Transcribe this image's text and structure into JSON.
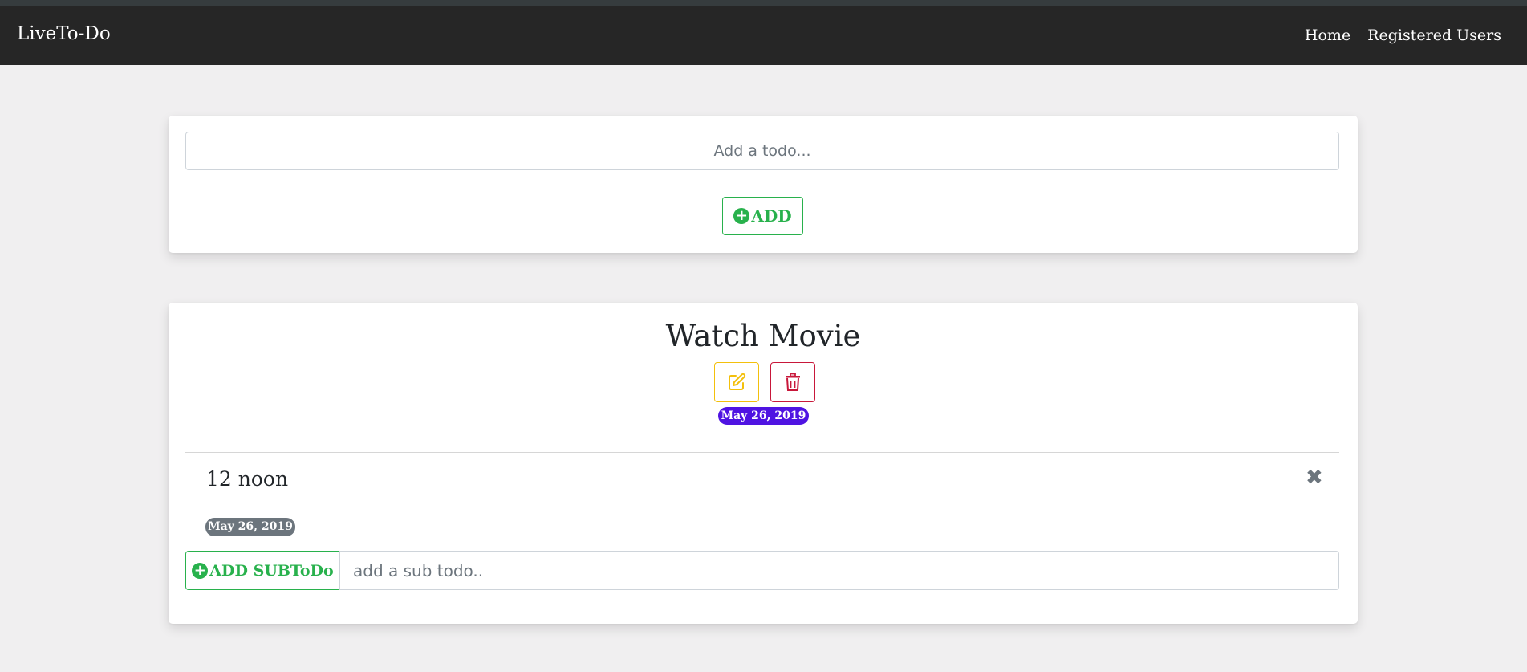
{
  "navbar": {
    "brand": "LiveTo-Do",
    "links": [
      "Home",
      "Registered Users"
    ]
  },
  "add_card": {
    "input_placeholder": "Add a todo...",
    "add_label": "ADD",
    "add_icon": "plus-circle-icon"
  },
  "todo": {
    "title": "Watch Movie",
    "edit_icon": "edit-icon",
    "delete_icon": "trash-icon",
    "date": "May 26, 2019",
    "subtodos": [
      {
        "text": "12 noon",
        "date": "May 26, 2019",
        "remove_icon": "close-icon"
      }
    ],
    "add_sub_label": "ADD SUBToDo",
    "sub_input_placeholder": "add a sub todo.."
  },
  "colors": {
    "navbar_bg": "#262626",
    "page_bg": "#f0eff0",
    "success": "#28b14c",
    "warning": "#f3c00c",
    "danger": "#c8173a",
    "date_badge": "#4f13e2",
    "secondary_badge": "#6c757d"
  }
}
